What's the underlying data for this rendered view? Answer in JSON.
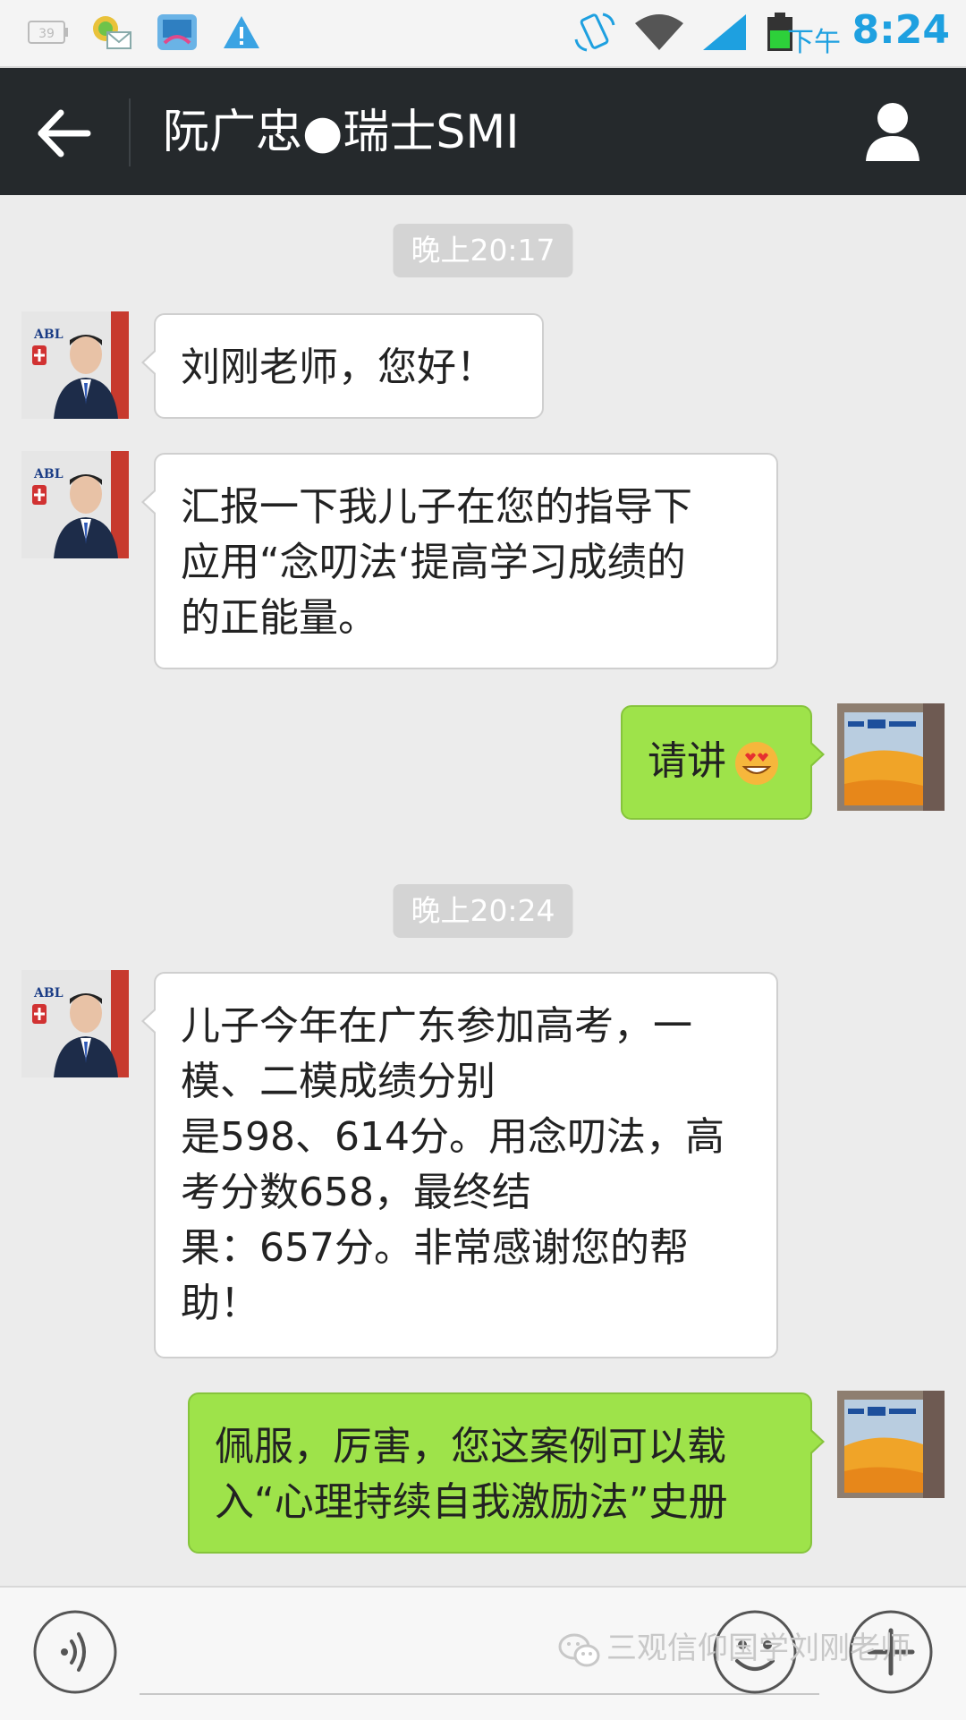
{
  "status_bar": {
    "ampm": "下午",
    "time": "8:24",
    "battery_label": "39",
    "icons": [
      "battery-box-icon",
      "mail-notification-icon",
      "app-notification-icon",
      "warning-icon",
      "rotate-screen-icon",
      "wifi-icon",
      "signal-icon",
      "battery-icon"
    ]
  },
  "header": {
    "back_icon": "arrow-left-icon",
    "title": "阮广忠●瑞士SMI",
    "profile_icon": "person-icon"
  },
  "chat": {
    "timestamp_1": "晚上20:17",
    "msg_1": "刘刚老师，您好！",
    "msg_2_lines": [
      "汇报一下我儿子在您的指导下",
      "应用“念叨法‘提高学习成绩的",
      "的正能量。"
    ],
    "msg_3": "请讲",
    "msg_3_emoji": "heart-eyes-emoji",
    "timestamp_2": "晚上20:24",
    "msg_4_lines": [
      "儿子今年在广东参加高考，一",
      "模、二模成绩分别",
      "是598、614分。用念叨法，高",
      "考分数658，最终结",
      "果：657分。非常感谢您的帮",
      "助！"
    ],
    "msg_5_lines": [
      "佩服，厉害，您这案例可以载",
      "入“心理持续自我激励法”史册"
    ]
  },
  "input_bar": {
    "voice_icon": "voice-icon",
    "emoji_icon": "emoji-smile-icon",
    "plus_icon": "plus-icon",
    "watermark": "三观信仰国学刘刚老师"
  },
  "colors": {
    "title_bar": "#25292c",
    "chat_bg": "#ececec",
    "sent_bubble": "#9ee34a",
    "received_bubble": "#ffffff",
    "timestamp_bg": "#d4d4d4",
    "status_time": "#1ea0e0"
  }
}
